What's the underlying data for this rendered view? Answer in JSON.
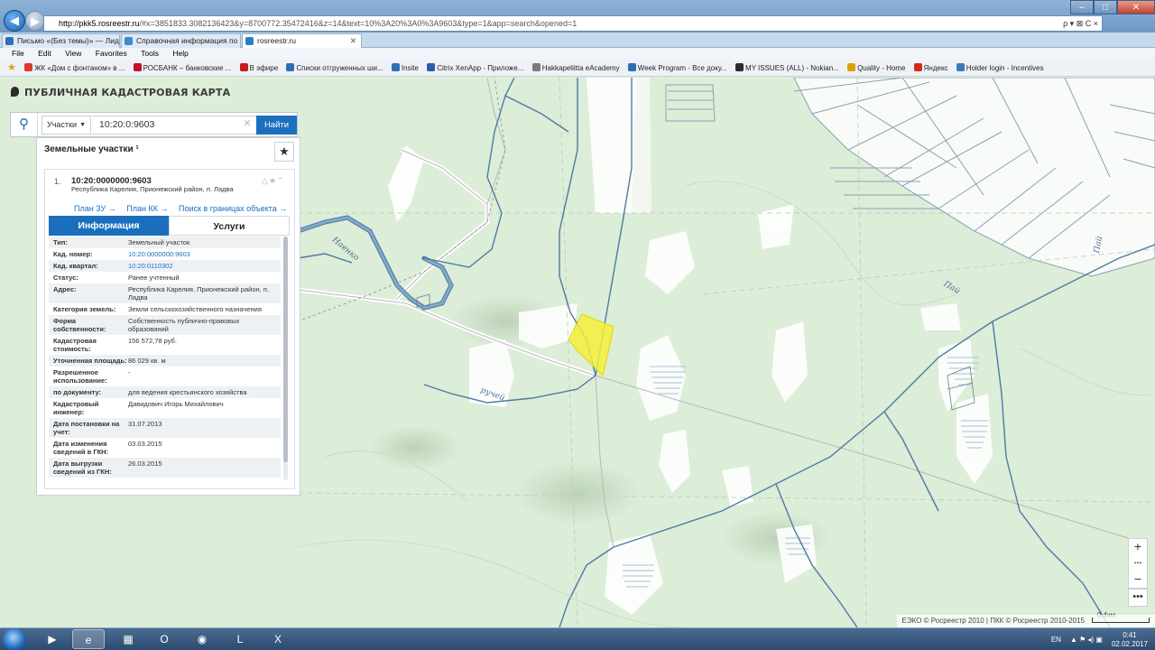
{
  "browser": {
    "url_host": "http://pkk5.rosreestr.ru",
    "url_rest": "/#x=3851833.3082136423&y=8700772.35472416&z=14&text=10%3A20%3A0%3A9603&type=1&app=search&opened=1",
    "address_icons": "ρ ▾ ⊠ C ×",
    "tabs": [
      {
        "label": "Письмо «(Без темы)» — Лиди...",
        "color": "#2f6fb3"
      },
      {
        "label": "Справочная информация по ...",
        "color": "#3a8bd2"
      },
      {
        "label": "rosreestr.ru",
        "color": "#2a7fc9"
      }
    ],
    "menu": [
      "File",
      "Edit",
      "View",
      "Favorites",
      "Tools",
      "Help"
    ],
    "favorites": [
      {
        "label": "ЖК «Дом с фонтаном» в ...",
        "color": "#d93a2b"
      },
      {
        "label": "РОСБАНК – банковские ...",
        "color": "#c0102a"
      },
      {
        "label": "В эфире",
        "color": "#c21e1e"
      },
      {
        "label": "Списки отгруженных ши...",
        "color": "#2f6fb3"
      },
      {
        "label": "Insite",
        "color": "#2f6fb3"
      },
      {
        "label": "Citrix XenApp - Приложе...",
        "color": "#2a5caa"
      },
      {
        "label": "Hakkapeliitta eAcademy",
        "color": "#7a7a7a"
      },
      {
        "label": "Week Program - Все доку...",
        "color": "#2f6fb3"
      },
      {
        "label": "MY ISSUES (ALL) - Nokian...",
        "color": "#2b2b2b"
      },
      {
        "label": "Quality - Home",
        "color": "#e0a000"
      },
      {
        "label": "Яндекс",
        "color": "#d12b1d"
      },
      {
        "label": "Holder login - Incentives",
        "color": "#3c79c0"
      }
    ]
  },
  "site": {
    "title": "ПУБЛИЧНАЯ КАДАСТРОВАЯ КАРТА"
  },
  "search": {
    "layer": "Участки",
    "query": "10:20:0:9603",
    "submit": "Найти"
  },
  "results": {
    "header": "Земельные участки ¹",
    "item_number": "1.",
    "cad_number": "10:20:0000000:9603",
    "address": "Республика Карелия, Прионежский район, п. Ладва",
    "links": [
      "План ЗУ →",
      "План КК →",
      "Поиск в границах объекта →"
    ],
    "tab_info": "Информация",
    "tab_services": "Услуги",
    "rows": [
      {
        "key": "Тип:",
        "value": "Земельный участок",
        "link": false
      },
      {
        "key": "Кад. номер:",
        "value": "10:20:0000000:9603",
        "link": true
      },
      {
        "key": "Кад. квартал:",
        "value": "10:20:0110302",
        "link": true
      },
      {
        "key": "Статус:",
        "value": "Ранее учтенный",
        "link": false
      },
      {
        "key": "Адрес:",
        "value": "Республика Карелия, Прионежский район, п. Ладва",
        "link": false
      },
      {
        "key": "Категория земель:",
        "value": "Земли сельскохозяйственного назначения",
        "link": false
      },
      {
        "key": "Форма собственности:",
        "value": "Собственность публично-правовых образований",
        "link": false
      },
      {
        "key": "Кадастровая стоимость:",
        "value": "156 572,78 руб.",
        "link": false
      },
      {
        "key": "Уточненная площадь:",
        "value": "86 029 кв. м",
        "link": false
      },
      {
        "key": "Разрешенное использование:",
        "value": "-",
        "link": false
      },
      {
        "key": "по документу:",
        "value": "для ведения крестьянского хозяйства",
        "link": false
      },
      {
        "key": "Кадастровый инженер:",
        "value": "Давидович Игорь Михайлович",
        "link": false
      },
      {
        "key": "Дата постановки на учет:",
        "value": "31.07.2013",
        "link": false
      },
      {
        "key": "Дата изменения сведений в ГКН:",
        "value": "03.03.2015",
        "link": false
      },
      {
        "key": "Дата выгрузки сведений из ГКН:",
        "value": "26.03.2015",
        "link": false
      }
    ]
  },
  "map": {
    "river_label_1": "Нaенко",
    "river_label_2": "Пай",
    "river_label_3": "Пай",
    "stream_label": "ручей",
    "zoom_in": "+",
    "zoom_dots": "•••",
    "zoom_out": "−",
    "more": "•••",
    "attribution": "ЕЭКО © Росреестр 2010 | ПКК © Росреестр 2010-2015",
    "scale": "0.4км",
    "highlight_color": "#f5ef3a"
  },
  "taskbar": {
    "lang": "EN",
    "time": "0:41",
    "date": "02.02.2017"
  }
}
